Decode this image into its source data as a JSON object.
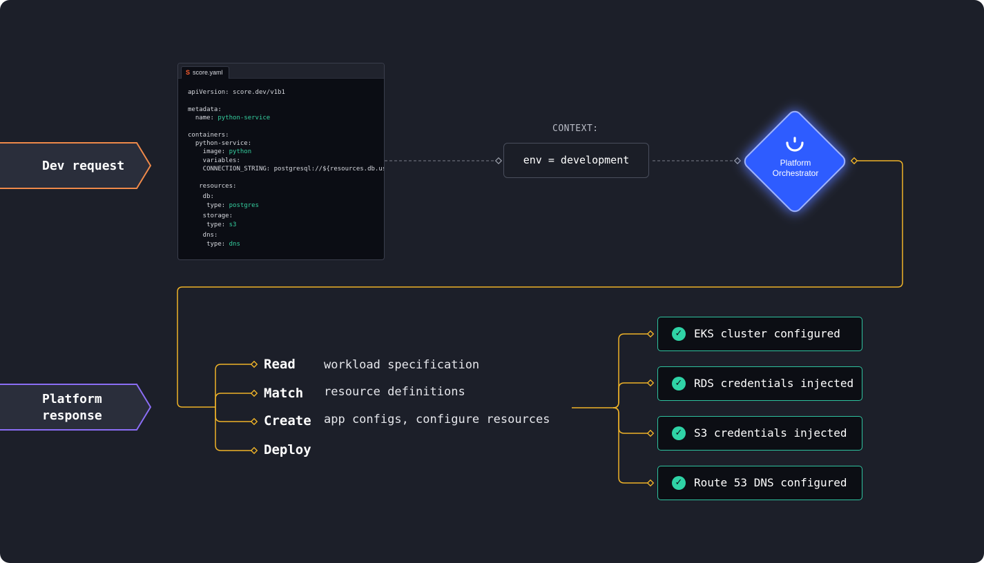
{
  "colors": {
    "background": "#1c1f29",
    "dev_request_accent": "#f08a4a",
    "platform_response_accent": "#8b6ef6",
    "orchestrator_blue": "#2f5bff",
    "connector_yellow": "#f0b429",
    "success_green": "#2fd3a6",
    "code_value_green": "#35d0a0"
  },
  "dev_request": {
    "label": "Dev request"
  },
  "platform_response": {
    "label_line1": "Platform",
    "label_line2": "response"
  },
  "code_editor": {
    "tab_icon": "score-logo-icon",
    "tab_logo_text": "S",
    "tab_name": "score.yaml",
    "lines": [
      {
        "text": "apiVersion: score.dev/v1b1",
        "value": ""
      },
      {
        "text": "metadata:",
        "value": ""
      },
      {
        "text": "  name: ",
        "value": "python-service"
      },
      {
        "text": "containers:",
        "value": ""
      },
      {
        "text": "  python-service:",
        "value": ""
      },
      {
        "text": "    image: ",
        "value": "python"
      },
      {
        "text": "    variables:",
        "value": ""
      },
      {
        "text": "    CONNECTION_STRING: postgresql://${resources.db.username}",
        "value": ""
      },
      {
        "text": "   resources:",
        "value": ""
      },
      {
        "text": "    db:",
        "value": ""
      },
      {
        "text": "     type: ",
        "value": "postgres"
      },
      {
        "text": "    storage:",
        "value": ""
      },
      {
        "text": "     type: ",
        "value": "s3"
      },
      {
        "text": "    dns:",
        "value": ""
      },
      {
        "text": "     type: ",
        "value": "dns"
      }
    ]
  },
  "context": {
    "label": "CONTEXT:",
    "value": "env = development"
  },
  "orchestrator": {
    "icon": "humanitec-logo-icon",
    "line1": "Platform",
    "line2": "Orchestrator"
  },
  "actions": [
    {
      "verb": "Read",
      "description": "workload specification"
    },
    {
      "verb": "Match",
      "description": "resource definitions"
    },
    {
      "verb": "Create",
      "description": "app configs, configure resources"
    },
    {
      "verb": "Deploy",
      "description": ""
    }
  ],
  "results": [
    {
      "icon": "check-circle-icon",
      "text": "EKS cluster configured"
    },
    {
      "icon": "check-circle-icon",
      "text": "RDS credentials injected"
    },
    {
      "icon": "check-circle-icon",
      "text": "S3 credentials injected"
    },
    {
      "icon": "check-circle-icon",
      "text": "Route 53 DNS configured"
    }
  ]
}
